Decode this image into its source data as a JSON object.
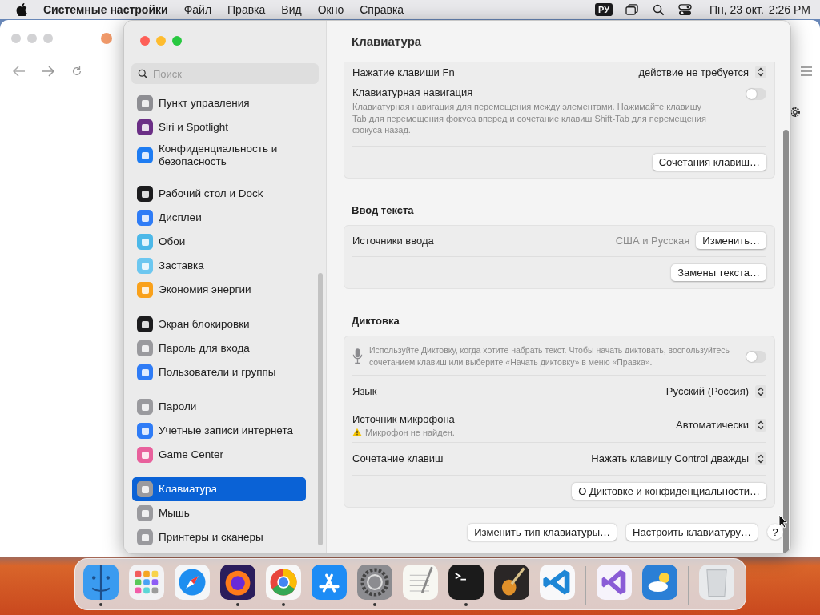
{
  "menu_bar": {
    "app_name": "Системные настройки",
    "menus": [
      "Файл",
      "Правка",
      "Вид",
      "Окно",
      "Справка"
    ],
    "input_source": "РУ",
    "date": "Пн, 23 окт.",
    "time": "2:26 PM"
  },
  "window": {
    "title": "Клавиатура"
  },
  "sidebar": {
    "search": {
      "placeholder": "Поиск"
    },
    "groups": [
      [
        {
          "label": "Пункт управления",
          "color": "#8e8e93",
          "selected": false
        },
        {
          "label": "Siri и Spotlight",
          "color": "#6b2f86",
          "selected": false
        },
        {
          "label": "Конфиденциальность и безопасность",
          "color": "#1e7cf2",
          "selected": false
        }
      ],
      [
        {
          "label": "Рабочий стол и Dock",
          "color": "#1c1c1e",
          "selected": false
        },
        {
          "label": "Дисплеи",
          "color": "#2f7cf6",
          "selected": false
        },
        {
          "label": "Обои",
          "color": "#4cb8e8",
          "selected": false
        },
        {
          "label": "Заставка",
          "color": "#6cc7f0",
          "selected": false
        },
        {
          "label": "Экономия энергии",
          "color": "#f9a11b",
          "selected": false
        }
      ],
      [
        {
          "label": "Экран блокировки",
          "color": "#1c1c1e",
          "selected": false
        },
        {
          "label": "Пароль для входа",
          "color": "#9a9a9e",
          "selected": false
        },
        {
          "label": "Пользователи и группы",
          "color": "#2f7cf6",
          "selected": false
        }
      ],
      [
        {
          "label": "Пароли",
          "color": "#9a9a9e",
          "selected": false
        },
        {
          "label": "Учетные записи интернета",
          "color": "#2f7cf6",
          "selected": false
        },
        {
          "label": "Game Center",
          "color": "#e8609c",
          "selected": false
        }
      ],
      [
        {
          "label": "Клавиатура",
          "color": "#9a9a9e",
          "selected": true
        },
        {
          "label": "Мышь",
          "color": "#9a9a9e",
          "selected": false
        },
        {
          "label": "Принтеры и сканеры",
          "color": "#9a9a9e",
          "selected": false
        }
      ]
    ]
  },
  "sections": [
    {
      "rows": [
        {
          "kind": "popup",
          "label": "Нажатие клавиши Fn",
          "value": "действие не требуется"
        },
        {
          "kind": "toggle",
          "label": "Клавиатурная навигация",
          "description": "Клавиатурная навигация для перемещения между элементами. Нажимайте клавишу Tab для перемещения фокуса вперед и сочетание клавиш Shift-Tab для перемещения фокуса назад.",
          "on": false
        },
        {
          "kind": "button",
          "button": "Сочетания клавиш…"
        }
      ]
    },
    {
      "heading": "Ввод текста",
      "rows": [
        {
          "kind": "value_button",
          "label": "Источники ввода",
          "value": "США и Русская",
          "button": "Изменить…"
        },
        {
          "kind": "button",
          "button": "Замены текста…"
        }
      ]
    },
    {
      "heading": "Диктовка",
      "rows": [
        {
          "kind": "mic_toggle",
          "description": "Используйте Диктовку, когда хотите набрать текст. Чтобы начать диктовать, воспользуйтесь сочетанием клавиш или выберите «Начать диктовку» в меню «Правка».",
          "on": false
        },
        {
          "kind": "popup",
          "label": "Язык",
          "value": "Русский (Россия)"
        },
        {
          "kind": "popup",
          "label": "Источник микрофона",
          "value": "Автоматически",
          "warning": "Микрофон не найден."
        },
        {
          "kind": "popup",
          "label": "Сочетание клавиш",
          "value": "Нажать клавишу Control дважды"
        },
        {
          "kind": "button",
          "button": "О Диктовке и конфиденциальности…"
        }
      ]
    }
  ],
  "footer_buttons": [
    "Изменить тип клавиатуры…",
    "Настроить клавиатуру…"
  ],
  "help_button": "?",
  "dock": [
    {
      "kind": "finder",
      "running": true
    },
    {
      "kind": "launchpad",
      "running": false
    },
    {
      "kind": "safari",
      "running": false
    },
    {
      "kind": "firefox",
      "running": true
    },
    {
      "kind": "chrome",
      "running": true
    },
    {
      "kind": "appstore",
      "running": false
    },
    {
      "kind": "settings",
      "running": true
    },
    {
      "kind": "textedit",
      "running": false
    },
    {
      "kind": "terminal",
      "running": true
    },
    {
      "kind": "garageband",
      "running": false
    },
    {
      "kind": "vscode",
      "running": false
    },
    {
      "kind": "separator"
    },
    {
      "kind": "visualstudio",
      "running": false
    },
    {
      "kind": "weather",
      "running": false
    },
    {
      "kind": "separator"
    },
    {
      "kind": "trash",
      "running": false
    }
  ]
}
